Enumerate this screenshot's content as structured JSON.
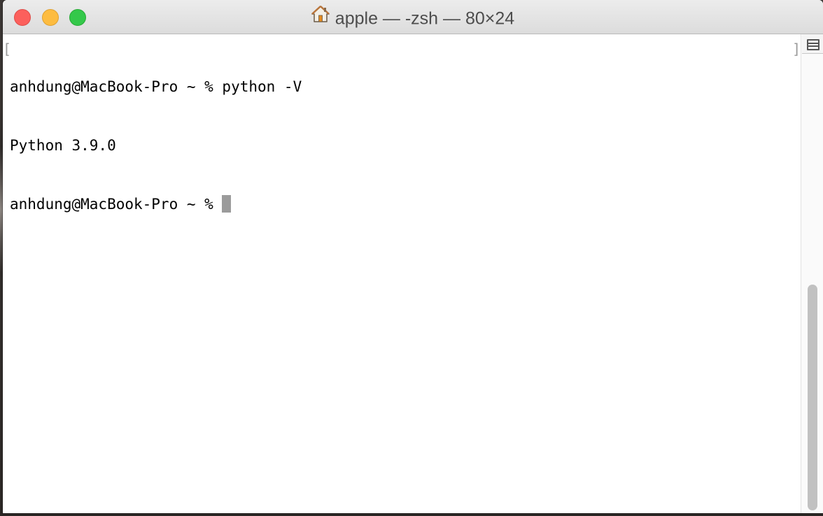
{
  "window": {
    "title": "apple — -zsh — 80×24",
    "title_icon": "home-icon"
  },
  "terminal": {
    "lines": [
      "anhdung@MacBook-Pro ~ % python -V",
      "Python 3.9.0",
      "anhdung@MacBook-Pro ~ % "
    ],
    "cursor_color": "#9b9b9b"
  },
  "colors": {
    "close": "#fc605c",
    "minimize": "#fdbc40",
    "zoom": "#34c84a"
  }
}
